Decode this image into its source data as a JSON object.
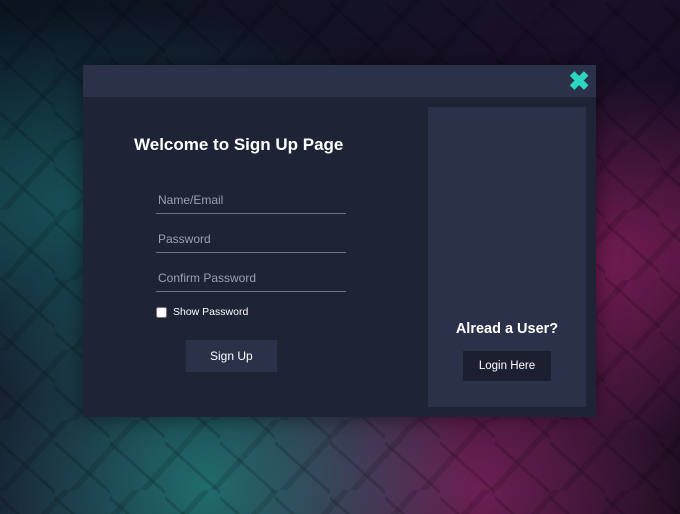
{
  "modal": {
    "close_label": "✖",
    "signup": {
      "title": "Welcome to Sign Up Page",
      "fields": {
        "name_placeholder": "Name/Email",
        "password_placeholder": "Password",
        "confirm_password_placeholder": "Confirm Password"
      },
      "show_password_label": "Show Password",
      "signup_button_label": "Sign Up"
    },
    "login": {
      "heading": "Alread a User?",
      "login_button_label": "Login Here"
    }
  }
}
